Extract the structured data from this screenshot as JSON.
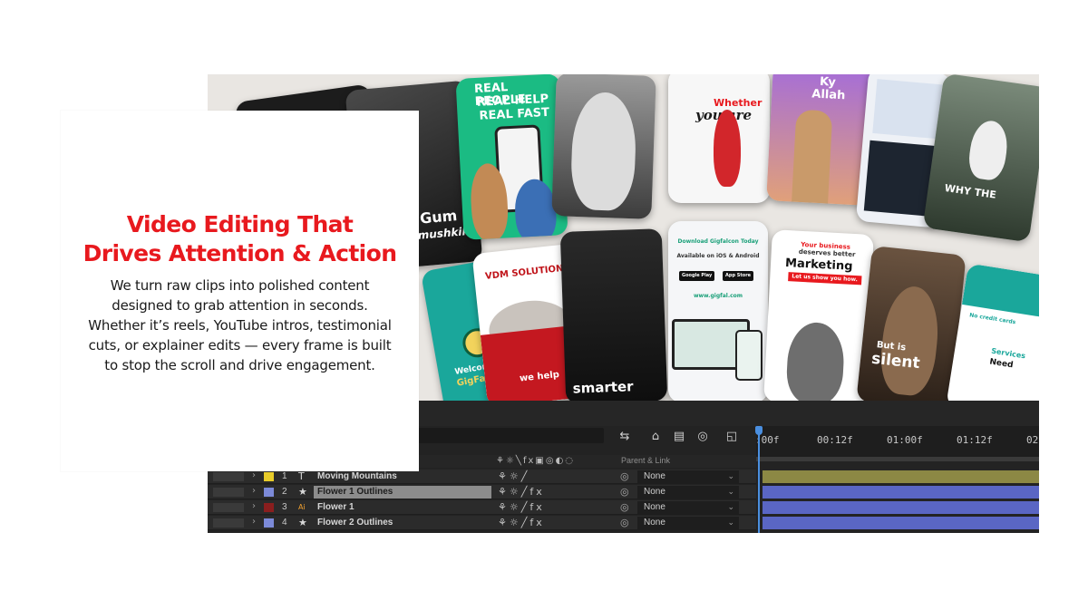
{
  "hero": {
    "headline_line1": "Video Editing That",
    "headline_line2": "Drives Attention & Action",
    "body": "We turn raw clips into polished content designed to grab attention in seconds. Whether it’s reels, YouTube intros, testimonial cuts, or explainer edits — every frame is built to stop the scroll and drive engagement.",
    "accent_color": "#e8191e"
  },
  "thumbnails": {
    "gum_line1": "Gum",
    "gum_line2": "mushkilat",
    "real_line1": "REAL PEOPLE",
    "real_line2": "REAL HELP",
    "real_line3": "REAL FAST",
    "whether": "Whether",
    "you_are": "you are",
    "ky_line1": "Ky",
    "ky_line2": "Allah",
    "why_the": "WHY THE",
    "welcome_line1": "Welcome to",
    "welcome_line2": "GigFalcon",
    "vdm": "VDM SOLUTIONS",
    "we_help": "we help",
    "smarter": "smarter",
    "download_title": "Download Gigfalcon Today",
    "download_sub": "Available on iOS & Android",
    "download_url": "www.gigfal.com",
    "google_play": "Google Play",
    "app_store": "App Store",
    "biz_line1": "Your business",
    "biz_line2": "deserves better",
    "marketing": "Marketing",
    "let_us": "Let us show you how.",
    "but_is": "But is",
    "silent": "silent",
    "services": "Services",
    "need": "Need",
    "no_credit": "No credit cards"
  },
  "timeline": {
    "ruler_ticks": [
      ":00f",
      "00:12f",
      "01:00f",
      "01:12f",
      "02"
    ],
    "parent_header": "Parent & Link",
    "layers": [
      {
        "num": "1",
        "name": "Moving Mountains",
        "parent": "None",
        "swatch": "#e8cc2a",
        "bar_color": "#8c8844",
        "type_icon": "T",
        "selected": false
      },
      {
        "num": "2",
        "name": "Flower 1 Outlines",
        "parent": "None",
        "swatch": "#7c8ad8",
        "bar_color": "#5a66c4",
        "type_icon": "★",
        "selected": true
      },
      {
        "num": "3",
        "name": "Flower 1",
        "parent": "None",
        "swatch": "#8a1e1e",
        "bar_color": "#5a66c4",
        "type_icon": "Ai",
        "selected": false
      },
      {
        "num": "4",
        "name": "Flower 2 Outlines",
        "parent": "None",
        "swatch": "#7c8ad8",
        "bar_color": "#5a66c4",
        "type_icon": "★",
        "selected": false
      }
    ]
  }
}
